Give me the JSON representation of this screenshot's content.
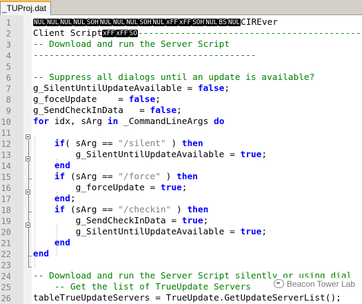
{
  "tab": {
    "label": "_TUProj.dat"
  },
  "gutter": {
    "line_numbers": [
      "1",
      "2",
      "3",
      "4",
      "5",
      "6",
      "7",
      "8",
      "9",
      "10",
      "11",
      "12",
      "13",
      "14",
      "15",
      "16",
      "17",
      "18",
      "19",
      "20",
      "21",
      "22",
      "23",
      "24",
      "25",
      "26"
    ]
  },
  "code": {
    "l1_ctl": [
      "NUL",
      "NUL",
      "NUL",
      "NUL",
      "SOH",
      "NUL",
      "NUL",
      "NUL",
      "SOH",
      "NUL",
      "xFF",
      "xFF",
      "SOH",
      "NUL",
      "BS",
      "NUL"
    ],
    "l1_text": "CIREver",
    "l2_text": "Client Script",
    "l2_ctl": [
      "xFF",
      "xFF",
      "SO"
    ],
    "l2_dashes": "--------------------------------------------",
    "l3": "-- Download and run the Server Script",
    "l4": "------------------------------------------",
    "l6": "-- Suppress all dialogs until an update is available?",
    "l7": {
      "name": "g_SilentUntilUpdateAvailable = ",
      "kw": "false",
      "end": ";"
    },
    "l8": {
      "name": "g_foceUpdate    = ",
      "kw": "false",
      "end": ";"
    },
    "l9": {
      "name": "g_SendCheckInData   = ",
      "kw": "false",
      "end": ";"
    },
    "l10": {
      "kw1": "for",
      "mid": " idx, sArg ",
      "kw2": "in",
      "mid2": " _CommandLineArgs ",
      "kw3": "do"
    },
    "l12": {
      "kw1": "if",
      "a": "( sArg == ",
      "str": "\"/silent\"",
      "b": " ) ",
      "kw2": "then"
    },
    "l13": {
      "name": "g_SilentUntilUpdateAvailable = ",
      "kw": "true",
      "end": ";"
    },
    "l14": {
      "kw": "end"
    },
    "l15": {
      "kw1": "if",
      "a": " (sArg == ",
      "str": "\"/force\"",
      "b": " ) ",
      "kw2": "then"
    },
    "l16": {
      "name": "g_forceUpdate = ",
      "kw": "true",
      "end": ";"
    },
    "l17": {
      "kw": "end",
      "end": ";"
    },
    "l18": {
      "kw1": "if",
      "a": " (sArg == ",
      "str": "\"/checkin\"",
      "b": " ) ",
      "kw2": "then"
    },
    "l19": {
      "name": "g_SendCheckInData = ",
      "kw": "true",
      "end": ";"
    },
    "l20": {
      "name": "g_SilentUntilUpdateAvailable = ",
      "kw": "true",
      "end": ";"
    },
    "l21": {
      "kw": "end"
    },
    "l22": {
      "kw": "end"
    },
    "l24": "-- Download and run the Server Script silently or using dial",
    "l25": "-- Get the list of TrueUpdate Servers",
    "l26": "tableTrueUpdateServers = TrueUpdate.GetUpdateServerList();"
  },
  "watermark": {
    "text": "Beacon Tower Lab",
    "icon": "wechat-icon"
  }
}
